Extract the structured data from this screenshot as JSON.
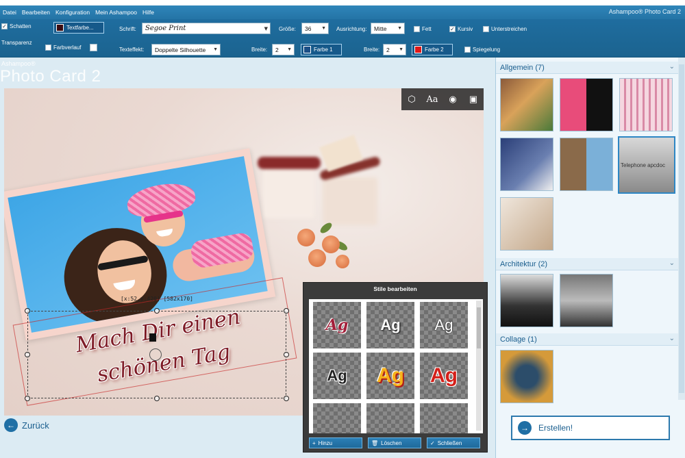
{
  "menu": [
    "Datei",
    "Bearbeiten",
    "Konfiguration",
    "Mein Ashampoo",
    "Hilfe"
  ],
  "brand": "Ashampoo® Photo Card 2",
  "toolbar": {
    "shadow_label": "Schatten",
    "transparency_label": "Transparenz",
    "textcolor_label": "Textfarbe...",
    "gradient_label": "Farbverlauf",
    "font_label": "Schrift:",
    "font_value": "Segoe Print",
    "effect_label": "Texteffekt:",
    "effect_value": "Doppelte Silhouette",
    "size_label": "Größe:",
    "size_value": "36",
    "width_label": "Breite:",
    "width1_value": "2",
    "color1_label": "Farbe 1",
    "align_label": "Ausrichtung:",
    "align_value": "Mitte",
    "width2_label": "Breite:",
    "width2_value": "2",
    "color2_label": "Farbe 2",
    "bold_label": "Fett",
    "italic_label": "Kursiv",
    "underline_label": "Unterstreichen",
    "mirror_label": "Spiegelung",
    "colors": {
      "textcolor": "#3a0c12",
      "color1": "#1b4f86",
      "color2": "#e01818"
    }
  },
  "logo": {
    "small": "Ashampoo®",
    "big": "Photo Card 2"
  },
  "canvas": {
    "tool_icons": [
      "3d-box-icon",
      "text-style-icon",
      "stamp-icon",
      "photo-frame-icon"
    ],
    "selection_info": "[x:52,y:420] [582x170]",
    "card_text_line1": "Mach Dir einen",
    "card_text_line2": "schönen Tag"
  },
  "back_label": "Zurück",
  "styles_dialog": {
    "title": "Stile bearbeiten",
    "tiles": [
      "Ag",
      "Ag",
      "Ag",
      "Ag",
      "Ag",
      "Ag"
    ],
    "add_label": "Hinzu",
    "delete_label": "Löschen",
    "close_label": "Schließen"
  },
  "panel": {
    "sections": [
      {
        "title": "Allgemein (7)"
      },
      {
        "title": "Architektur (2)"
      },
      {
        "title": "Collage (1)"
      }
    ],
    "selected_thumb_caption": "Telephone apcdoc",
    "create_label": "Erstellen!"
  }
}
